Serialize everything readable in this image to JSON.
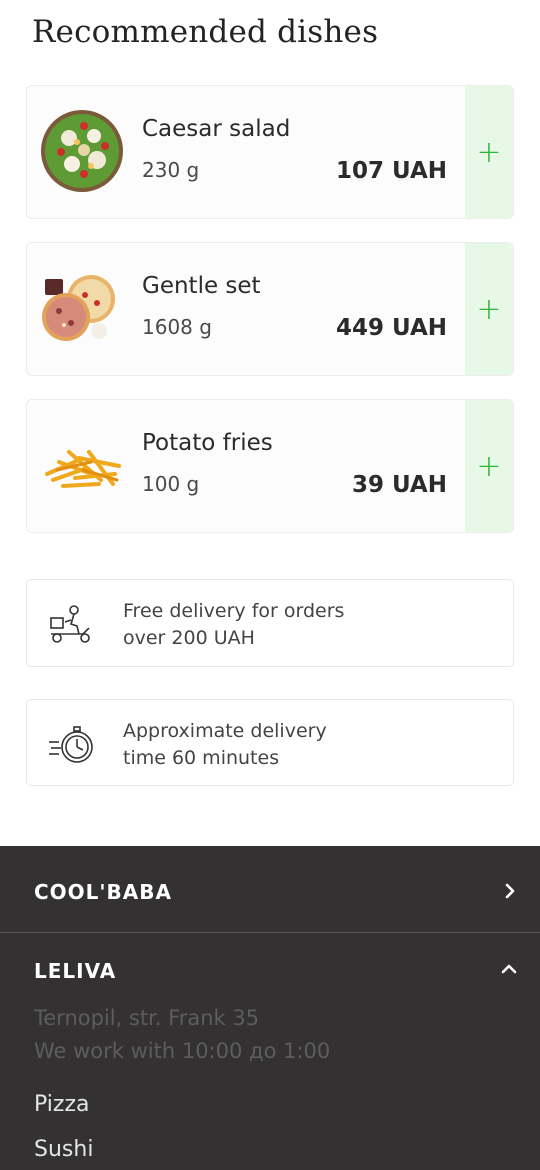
{
  "section": {
    "title": "Recommended dishes"
  },
  "dishes": [
    {
      "name": "Caesar salad",
      "weight": "230 g",
      "price": "107 UAH",
      "add": "+"
    },
    {
      "name": "Gentle set",
      "weight": "1608 g",
      "price": "449 UAH",
      "add": "+"
    },
    {
      "name": "Potato fries",
      "weight": "100 g",
      "price": "39 UAH",
      "add": "+"
    }
  ],
  "info": {
    "delivery_free_line1": "Free delivery for orders",
    "delivery_free_line2": "over 200 UAH",
    "delivery_time_line1": "Approximate delivery",
    "delivery_time_line2": "time 60 minutes"
  },
  "footer": {
    "restaurants": [
      {
        "name": "COOL'BABA",
        "state": "collapsed"
      },
      {
        "name": "LELIVA",
        "state": "expanded"
      }
    ],
    "address": "Ternopil, str. Frank 35",
    "hours": "We work with 10:00 до 1:00",
    "categories": [
      "Pizza",
      "Sushi"
    ]
  },
  "colors": {
    "accent": "#2fb53a",
    "add_bg": "#e8f8e6",
    "footer_bg": "#333132"
  }
}
